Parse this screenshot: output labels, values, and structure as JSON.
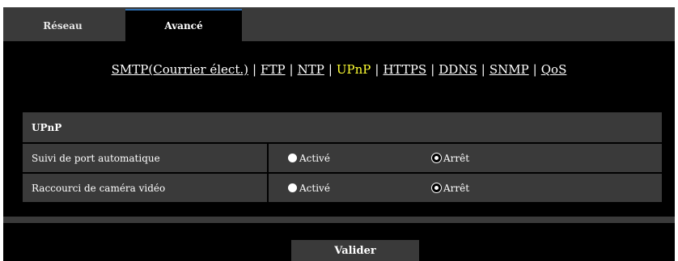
{
  "tabs": [
    {
      "label": "Réseau",
      "active": false
    },
    {
      "label": "Avancé",
      "active": true
    }
  ],
  "subnav": {
    "items": [
      {
        "label": "SMTP(Courrier élect.)",
        "active": false
      },
      {
        "label": "FTP",
        "active": false
      },
      {
        "label": "NTP",
        "active": false
      },
      {
        "label": "UPnP",
        "active": true
      },
      {
        "label": "HTTPS",
        "active": false
      },
      {
        "label": "DDNS",
        "active": false
      },
      {
        "label": "SNMP",
        "active": false
      },
      {
        "label": "QoS",
        "active": false
      }
    ],
    "separator": "|"
  },
  "section": {
    "title": "UPnP"
  },
  "settings": [
    {
      "label": "Suivi de port automatique",
      "options": [
        {
          "label": "Activé",
          "checked": false
        },
        {
          "label": "Arrêt",
          "checked": true
        }
      ]
    },
    {
      "label": "Raccourci de caméra vidéo",
      "options": [
        {
          "label": "Activé",
          "checked": false
        },
        {
          "label": "Arrêt",
          "checked": true
        }
      ]
    }
  ],
  "submit": {
    "label": "Valider"
  },
  "colors": {
    "background": "#000000",
    "panel": "#3a3a3a",
    "active_link": "#ffff33",
    "tab_accent": "#2f6fb0"
  }
}
